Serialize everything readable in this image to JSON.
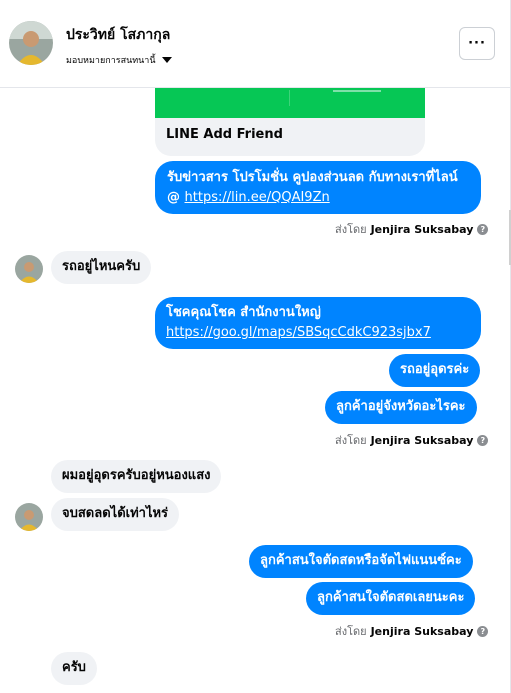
{
  "header": {
    "contact_name": "ประวิทย์ โสภากุล",
    "assign_label": "มอบหมายการสนทนานี้",
    "more_label": "···"
  },
  "card": {
    "title": "LINE Add Friend"
  },
  "messages": {
    "m1_line1": "รับข่าวสาร  โปรโมชั่น คูปองส่วนลด กับทางเราที่ไลน์",
    "m1_prefix": "@ ",
    "m1_link": "https://lin.ee/QQAI9Zn",
    "m2": "รถอยู่ไหนครับ",
    "m3_line1": "โชคคุณโชค สำนักงานใหญ่",
    "m3_link": "https://goo.gl/maps/SBSqcCdkC923sjbx7",
    "m4": "รถอยู่อุดรค่ะ",
    "m5": "ลูกค้าอยู่จังหวัดอะไรคะ",
    "m6": "ผมอยู่อุดรครับอยู่หนองแสง",
    "m7": "จบสดลดได้เท่าไหร่",
    "m8": "ลูกค้าสนใจตัดสดหรือจัดไฟแนนซ์คะ",
    "m9": "ลูกค้าสนใจตัดสดเลยนะคะ",
    "m10": "ครับ"
  },
  "sent_by": {
    "prefix": "ส่งโดย",
    "name": "Jenjira Suksabay"
  },
  "colors": {
    "outgoing": "#0084ff",
    "incoming": "#f0f2f5"
  }
}
